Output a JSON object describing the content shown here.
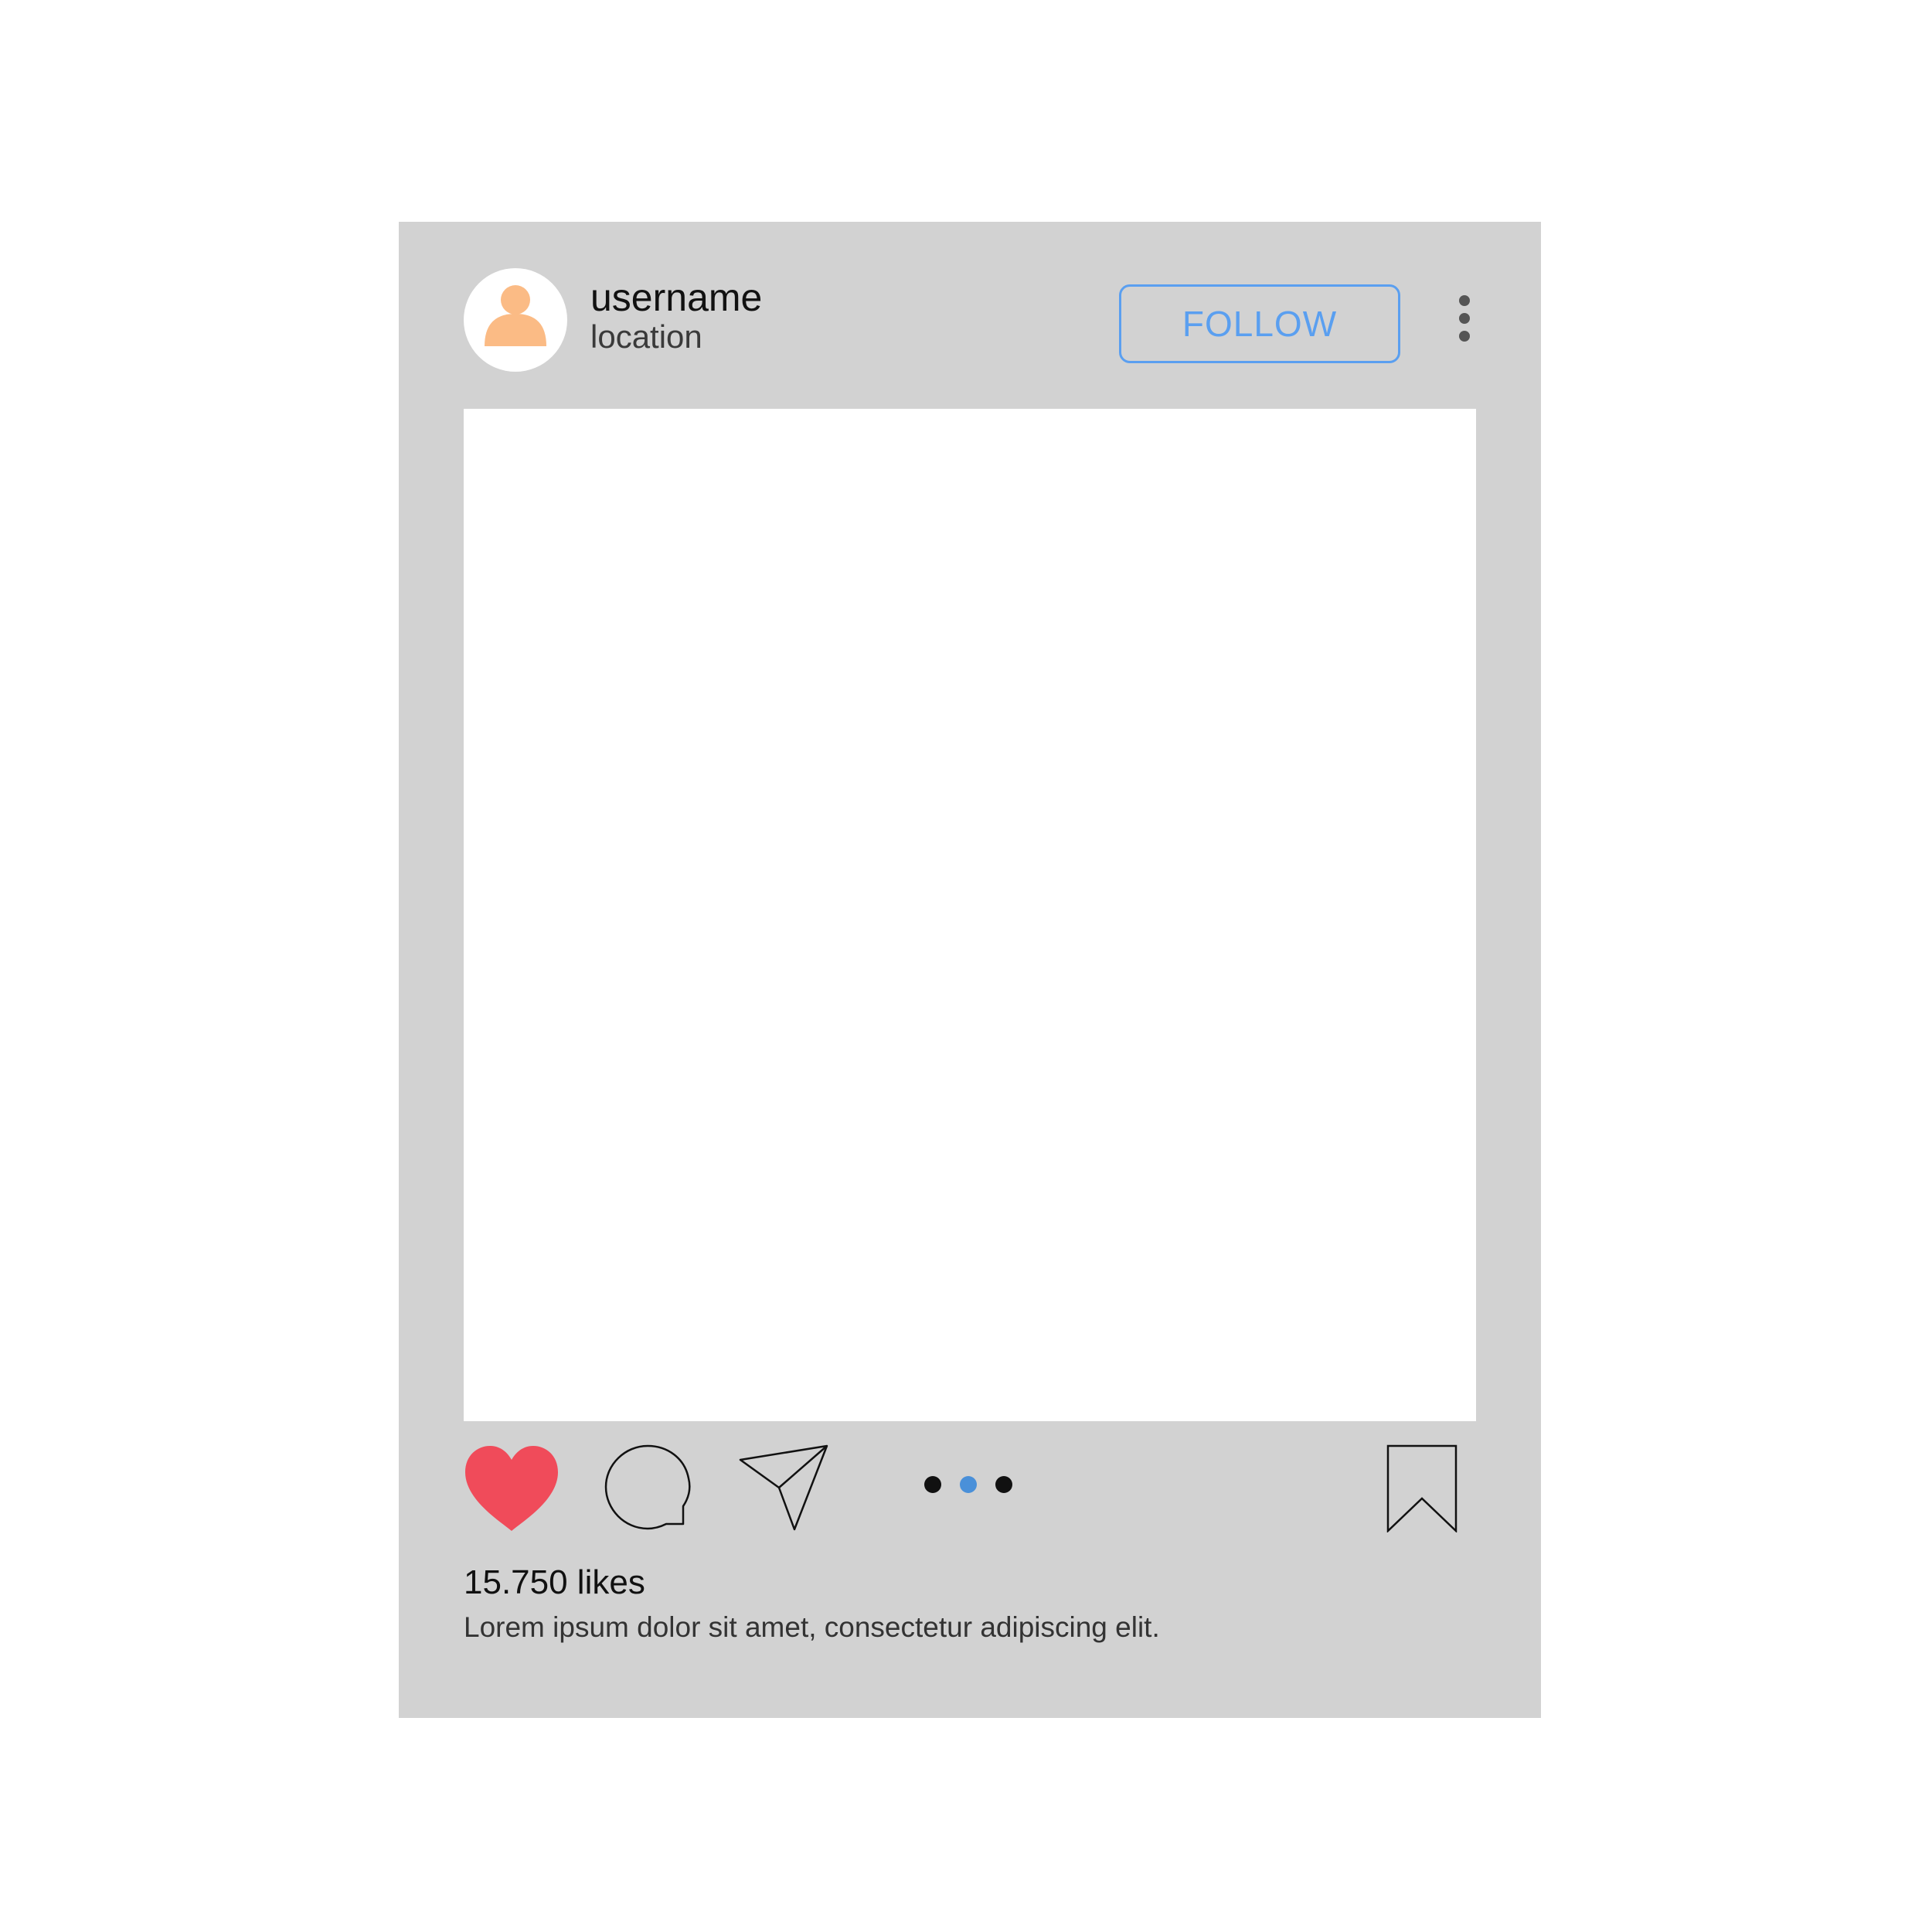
{
  "post": {
    "header": {
      "username": "username",
      "location": "location",
      "follow_label": "FOLLOW",
      "avatar_icon": "user-avatar-icon",
      "more_icon": "more-vertical-icon"
    },
    "actions": {
      "like_icon": "heart-icon",
      "comment_icon": "comment-bubble-icon",
      "share_icon": "paper-plane-icon",
      "save_icon": "bookmark-icon",
      "carousel_pages": 3,
      "carousel_active_page": 2
    },
    "likes_text": "15.750 likes",
    "caption": "Lorem ipsum dolor sit amet, consectetur adipiscing elit."
  },
  "colors": {
    "card_background": "#d2d2d2",
    "photo_background": "#ffffff",
    "accent_blue": "#5a9ff0",
    "heart_red": "#f04b5a",
    "avatar_peach": "#fbbb85",
    "dot_inactive": "#111111",
    "dot_active": "#4a90d9",
    "more_dots": "#555555"
  }
}
